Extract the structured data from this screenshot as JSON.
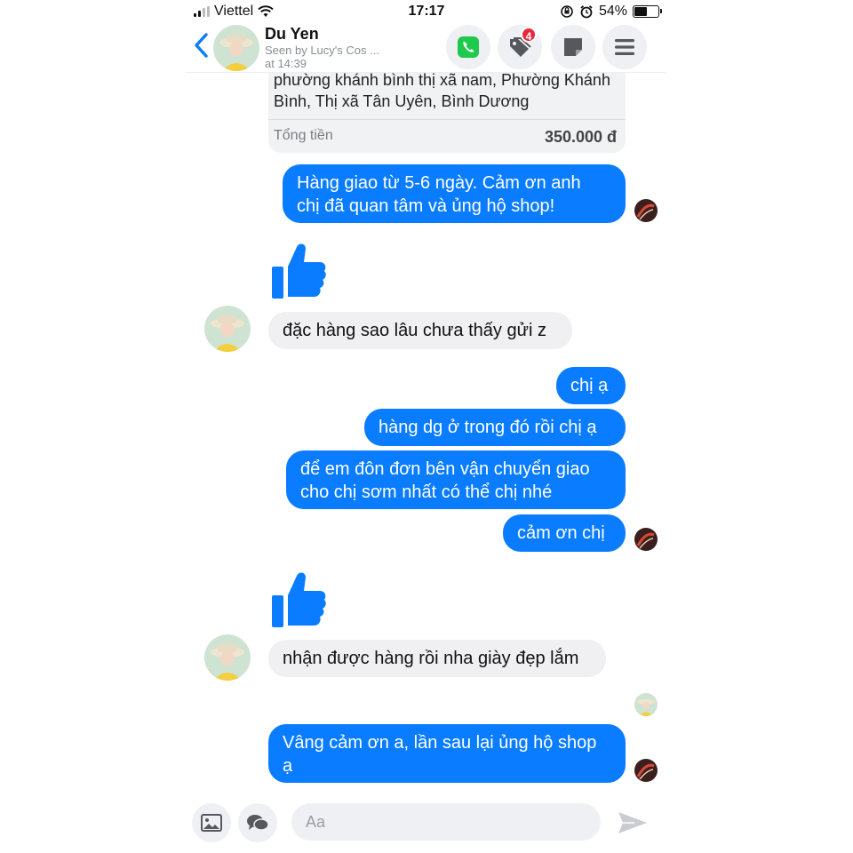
{
  "status_bar": {
    "carrier": "Viettel",
    "time": "17:17",
    "battery": "54%",
    "battery_level": 0.54
  },
  "header": {
    "name": "Du Yen",
    "seen_line1": "Seen by Lucy's Cos ...",
    "seen_line2": "at 14:39",
    "tag_badge": "4",
    "icons": [
      "back-chevron-icon",
      "phone-icon",
      "tag-icon",
      "note-icon",
      "menu-icon"
    ]
  },
  "order": {
    "address_line1": "phường khánh bình thị xã nam, Phường Khánh",
    "address_line2": "Bình, Thị xã Tân Uyên, Bình Dương",
    "total_label": "Tổng tiền",
    "total_value": "350.000 đ"
  },
  "messages": [
    {
      "from": "me",
      "line1": "Hàng giao từ  5-6  ngày. Cảm ơn anh",
      "line2": "chị đã quan tâm và ủng hộ shop!"
    },
    {
      "from": "me",
      "type": "like"
    },
    {
      "from": "them",
      "text": "đặc hàng sao lâu chưa thấy gửi z"
    },
    {
      "from": "me",
      "text": "chị ạ"
    },
    {
      "from": "me",
      "text": "hàng dg ở trong đó rồi chị ạ"
    },
    {
      "from": "me",
      "line1": "để em đôn đơn bên vận chuyển giao",
      "line2": "cho chị sơm nhất có thể chị nhé"
    },
    {
      "from": "me",
      "text": "cảm ơn chị"
    },
    {
      "from": "me",
      "type": "like"
    },
    {
      "from": "them",
      "text": "nhận được hàng rồi nha giày đẹp lắm"
    },
    {
      "from": "me",
      "line1": "Vâng cảm ơn a, lần sau lại ủng hộ shop",
      "line2": "ạ"
    }
  ],
  "composer": {
    "placeholder": "Aa",
    "icons": [
      "image-icon",
      "chat-bubbles-icon",
      "send-icon"
    ]
  },
  "colors": {
    "outgoing_bubble": "#0a7cff",
    "incoming_bubble": "#f0f0f2",
    "accent": "#0a7cff"
  }
}
